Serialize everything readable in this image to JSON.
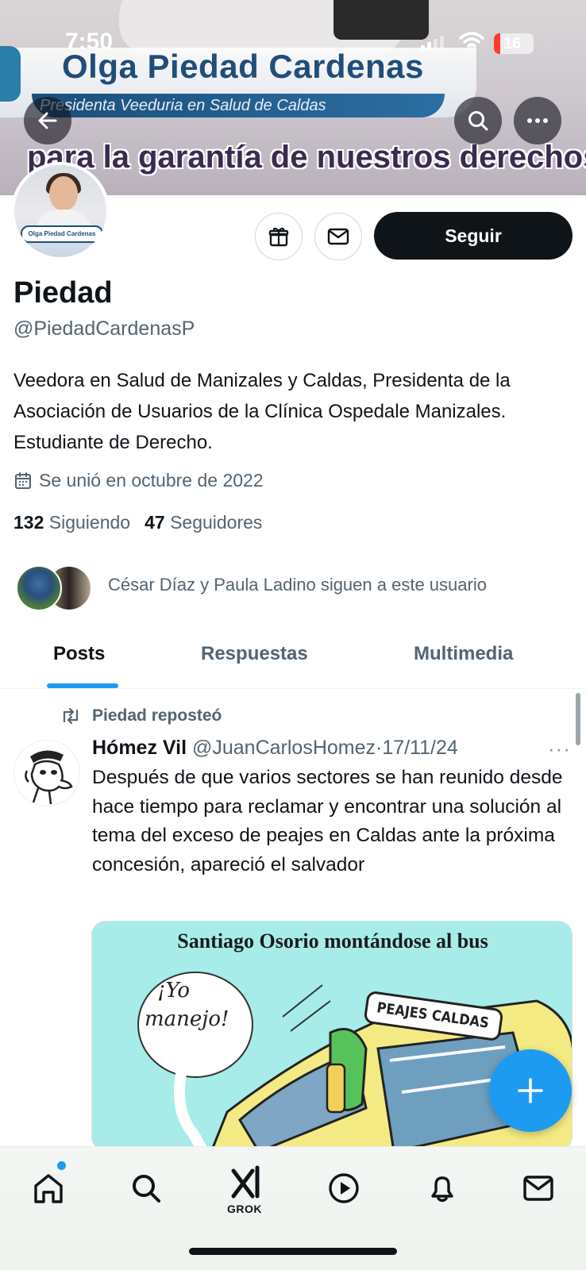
{
  "status_bar": {
    "time": "7:50",
    "battery": "16"
  },
  "banner": {
    "title": "Olga Piedad Cardenas",
    "subtitle": "Presidenta Veeduria en Salud de Caldas",
    "motto": "para la garantía de nuestros derechos f",
    "avatar_plate": "Olga Piedad Cardenas"
  },
  "actions": {
    "follow_label": "Seguir"
  },
  "profile": {
    "name": "Piedad",
    "handle": "@PiedadCardenasP",
    "bio": "Veedora en Salud de Manizales y Caldas, Presidenta de la Asociación de Usuarios de la Clínica Ospedale Manizales. Estudiante de Derecho.",
    "joined": "Se unió en octubre de 2022",
    "following_count": "132",
    "following_label": "Siguiendo",
    "followers_count": "47",
    "followers_label": "Seguidores",
    "followed_by": "César Díaz y Paula Ladino siguen a este usuario"
  },
  "tabs": [
    {
      "label": "Posts"
    },
    {
      "label": "Respuestas"
    },
    {
      "label": "Multimedia"
    }
  ],
  "post": {
    "repost_label": "Piedad reposteó",
    "author": "Hómez Vil",
    "handle": "@JuanCarlosHomez",
    "separator": "·",
    "date": "17/11/24",
    "more": "···",
    "text": "Después de que varios sectores se han reunido desde hace tiempo para reclamar y encontrar una solución al tema del exceso de peajes en Caldas ante la próxima concesión, apareció el salvador",
    "media": {
      "caption": "Santiago Osorio montándose al bus",
      "speech": [
        "¡Yo",
        "manejo!"
      ],
      "bus_sign": "PEAJES CALDAS"
    }
  },
  "bottom_nav": {
    "grok_label": "GROK",
    "items": [
      "home-icon",
      "search-icon",
      "grok-icon",
      "play-icon",
      "notifications-icon",
      "messages-icon"
    ]
  },
  "colors": {
    "accent": "#1d9bf0",
    "text": "#0f1419",
    "secondary": "#536471"
  }
}
